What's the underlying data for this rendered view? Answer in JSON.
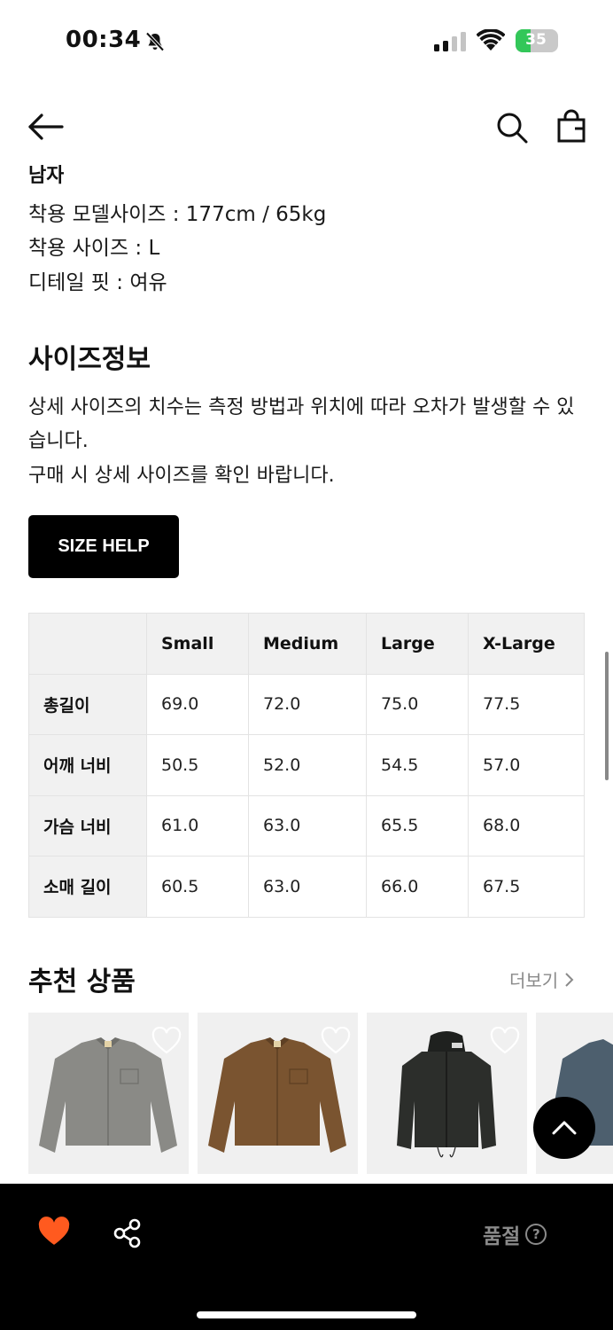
{
  "status": {
    "time": "00:34",
    "battery": "35",
    "battery_level": 0.35
  },
  "details": {
    "cut_label": "남자",
    "lines": [
      "착용 모델사이즈 : 177cm / 65kg",
      "착용 사이즈 : L",
      "디테일 핏 : 여유"
    ]
  },
  "size_info": {
    "title": "사이즈정보",
    "description": "상세 사이즈의 치수는 측정 방법과 위치에 따라 오차가 발생할 수 있습니다.",
    "note": "구매 시 상세 사이즈를 확인 바랍니다.",
    "help_button": "SIZE HELP",
    "table": {
      "columns": [
        "",
        "Small",
        "Medium",
        "Large",
        "X-Large"
      ],
      "rows": [
        {
          "label": "총길이",
          "values": [
            "69.0",
            "72.0",
            "75.0",
            "77.5"
          ]
        },
        {
          "label": "어깨 너비",
          "values": [
            "50.5",
            "52.0",
            "54.5",
            "57.0"
          ]
        },
        {
          "label": "가슴 너비",
          "values": [
            "61.0",
            "63.0",
            "65.5",
            "68.0"
          ]
        },
        {
          "label": "소매 길이",
          "values": [
            "60.5",
            "63.0",
            "66.0",
            "67.5"
          ]
        }
      ]
    }
  },
  "recommended": {
    "title": "추천 상품",
    "more": "더보기",
    "products": [
      {
        "kind": "grey-jacket",
        "color": "#8a8a86"
      },
      {
        "kind": "brown-jacket",
        "color": "#7a5430"
      },
      {
        "kind": "black-hooded-jacket",
        "color": "#2c2e2b"
      },
      {
        "kind": "blue-jacket",
        "color": "#4d5f6e"
      }
    ]
  },
  "bottom_bar": {
    "status": "품절",
    "help": "?",
    "heart_color": "#ff5a1f"
  }
}
